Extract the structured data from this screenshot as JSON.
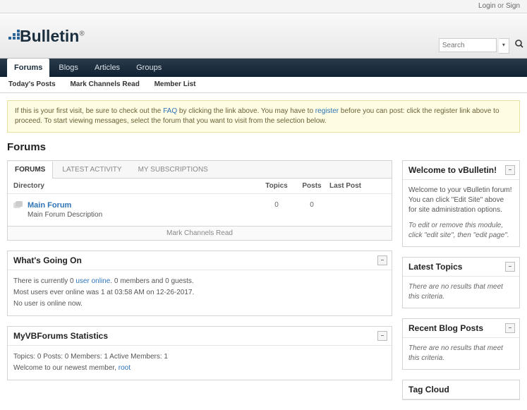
{
  "top": {
    "login": "Login",
    "or": "or",
    "sign": "Sign"
  },
  "brand": {
    "name": "Bulletin",
    "reg": "®"
  },
  "search": {
    "placeholder": "Search"
  },
  "nav": {
    "forums": "Forums",
    "blogs": "Blogs",
    "articles": "Articles",
    "groups": "Groups"
  },
  "subnav": {
    "todays": "Today's Posts",
    "mark": "Mark Channels Read",
    "members": "Member List"
  },
  "notice": {
    "p1a": "If this is your first visit, be sure to check out the ",
    "faq": "FAQ",
    "p1b": " by clicking the link above. You may have to ",
    "register": "register",
    "p1c": " before you can post: click the register link above to proceed. To start viewing messages, select the forum that you want to visit from the selection below."
  },
  "page_title": "Forums",
  "tabs": {
    "forums": "FORUMS",
    "latest": "LATEST ACTIVITY",
    "subs": "MY SUBSCRIPTIONS"
  },
  "cols": {
    "directory": "Directory",
    "topics": "Topics",
    "posts": "Posts",
    "last": "Last Post"
  },
  "forum": {
    "name": "Main Forum",
    "desc": "Main Forum Description",
    "topics": "0",
    "posts": "0"
  },
  "mark_read": "Mark Channels Read",
  "whats_going_on": {
    "title": "What's Going On",
    "line1a": "There is currently 0 ",
    "line1_link": "user online",
    "line1b": ". 0 members and 0 guests.",
    "line2": "Most users ever online was 1 at 03:58 AM on 12-26-2017.",
    "line3": "No user is online now."
  },
  "stats": {
    "title": "MyVBForums Statistics",
    "line1": "Topics: 0   Posts: 0   Members: 1   Active Members: 1",
    "line2a": "Welcome to our newest member, ",
    "line2_link": "root"
  },
  "side": {
    "welcome": {
      "title": "Welcome to vBulletin!",
      "p1": "Welcome to your vBulletin forum! You can click \"Edit Site\" above for site administration options.",
      "p2": "To edit or remove this module, click \"edit site\", then \"edit page\"."
    },
    "latest": {
      "title": "Latest Topics",
      "empty": "There are no results that meet this criteria."
    },
    "blog": {
      "title": "Recent Blog Posts",
      "empty": "There are no results that meet this criteria."
    },
    "tagcloud": {
      "title": "Tag Cloud"
    }
  }
}
